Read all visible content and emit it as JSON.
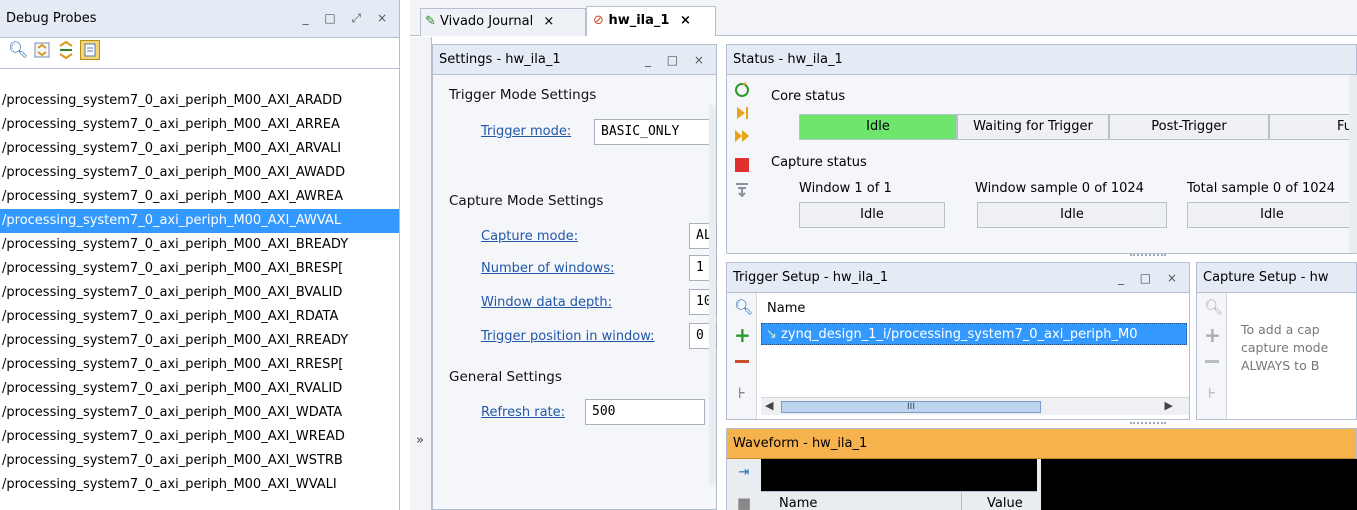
{
  "debug_probes": {
    "title": "Debug Probes",
    "controls": "_ □ ⤢ ×",
    "toolbar": [
      "search-icon",
      "collapse-all-icon",
      "expand-all-icon",
      "show-selected-icon"
    ],
    "items": [
      "/processing_system7_0_axi_periph_M00_AXI_ARADD",
      "/processing_system7_0_axi_periph_M00_AXI_ARREA",
      "/processing_system7_0_axi_periph_M00_AXI_ARVALI",
      "/processing_system7_0_axi_periph_M00_AXI_AWADD",
      "/processing_system7_0_axi_periph_M00_AXI_AWREA",
      "/processing_system7_0_axi_periph_M00_AXI_AWVAL",
      "/processing_system7_0_axi_periph_M00_AXI_BREADY",
      "/processing_system7_0_axi_periph_M00_AXI_BRESP[",
      "/processing_system7_0_axi_periph_M00_AXI_BVALID",
      "/processing_system7_0_axi_periph_M00_AXI_RDATA",
      "/processing_system7_0_axi_periph_M00_AXI_RREADY",
      "/processing_system7_0_axi_periph_M00_AXI_RRESP[",
      "/processing_system7_0_axi_periph_M00_AXI_RVALID",
      "/processing_system7_0_axi_periph_M00_AXI_WDATA",
      "/processing_system7_0_axi_periph_M00_AXI_WREAD",
      "/processing_system7_0_axi_periph_M00_AXI_WSTRB",
      "/processing_system7_0_axi_periph_M00_AXI_WVALI"
    ],
    "selected_index": 5
  },
  "tabs": [
    {
      "label": "Vivado Journal",
      "close": "×",
      "active": false
    },
    {
      "label": "hw_ila_1",
      "close": "×",
      "active": true
    }
  ],
  "collapse_glyph": "»",
  "settings": {
    "title": "Settings - hw_ila_1",
    "controls": "_ □ ×",
    "trigger_section": "Trigger Mode Settings",
    "trigger_mode_label": "Trigger mode:",
    "trigger_mode_value": "BASIC_ONLY",
    "capture_section": "Capture Mode Settings",
    "capture_mode_label": "Capture mode:",
    "capture_mode_value": "AL",
    "num_windows_label": "Number of windows:",
    "num_windows_value": "1",
    "window_depth_label": "Window data depth:",
    "window_depth_value": "10",
    "trigger_pos_label": "Trigger position in window:",
    "trigger_pos_value": "0",
    "general_section": "General Settings",
    "refresh_label": "Refresh rate:",
    "refresh_value": "500"
  },
  "status": {
    "title": "Status - hw_ila_1",
    "core_status_label": "Core status",
    "core_cells": [
      "Idle",
      "Waiting for Trigger",
      "Post-Trigger",
      "Fu"
    ],
    "active_color": "#6ee66e",
    "capture_status_label": "Capture status",
    "capture_headers": [
      "Window 1 of 1",
      "Window sample 0 of 1024",
      "Total sample 0 of 1024"
    ],
    "capture_values": [
      "Idle",
      "Idle",
      "Idle"
    ],
    "side_icons": [
      "auto-trigger-icon",
      "run-trigger-icon",
      "run-immediate-icon",
      "stop-icon",
      "capture-icon"
    ]
  },
  "trigger_setup": {
    "title": "Trigger Setup - hw_ila_1",
    "controls": "_ □ ×",
    "column_name": "Name",
    "row": "zynq_design_1_i/processing_system7_0_axi_periph_M0",
    "scroll_mark": "III"
  },
  "capture_setup": {
    "title": "Capture Setup - hw",
    "hint_lines": [
      "To add a cap",
      "capture mode",
      "ALWAYS to B"
    ]
  },
  "waveform": {
    "title": "Waveform - hw_ila_1",
    "col_name": "Name",
    "col_value": "Value"
  },
  "colors": {
    "header_bg": "#e4ebf5",
    "selection": "#3399ff",
    "link": "#2257a8",
    "waveform_header": "#f6b24d"
  }
}
